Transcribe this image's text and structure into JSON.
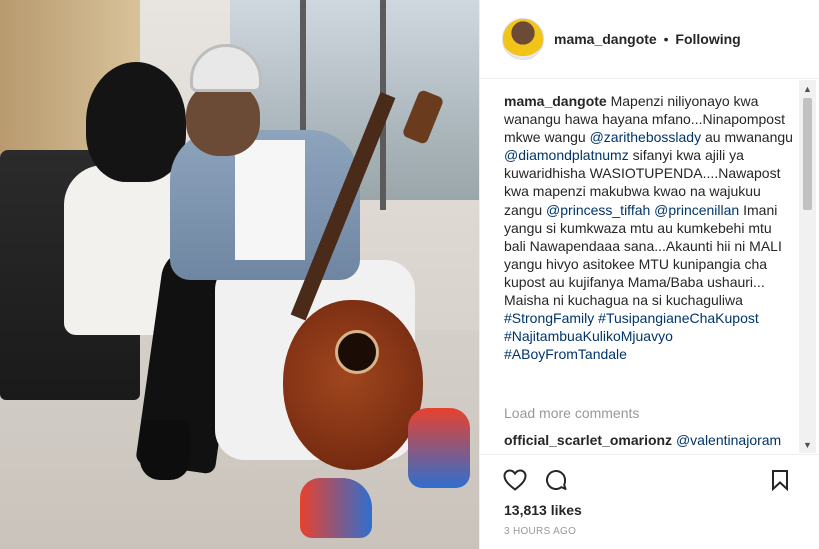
{
  "post": {
    "username": "mama_dangote",
    "separator": "•",
    "follow_status": "Following"
  },
  "caption": {
    "username": "mama_dangote",
    "part1": "Mapenzi niliyonayo kwa wanangu hawa hayana mfano...Ninapompost mkwe wangu",
    "mention1": "@zarithebosslady",
    "part2": "au mwanangu",
    "mention2": "@diamondplatnumz",
    "part3": "sifanyi kwa ajili ya kuwaridhisha WASIOTUPENDA....Nawapost kwa mapenzi makubwa kwao na wajukuu zangu",
    "mention3": "@princess_tiffah",
    "mention4": "@princenillan",
    "part4": "Imani yangu si kumkwaza mtu au kumkebehi mtu bali Nawapendaaa sana...Akaunti hii ni MALI yangu hivyo asitokee MTU kunipangia cha kupost au kujifanya Mama/Baba ushauri... Maisha ni kuchagua na si kuchaguliwa",
    "hashtag1": "#StrongFamily",
    "hashtag2": "#TusipangianeChaKupost",
    "hashtag3": "#NajitambuaKulikoMjuavyo",
    "hashtag4": "#ABoyFromTandale"
  },
  "load_more": "Load more comments",
  "comment": {
    "username": "official_scarlet_omarionz",
    "mention": "@valentinajoram"
  },
  "actions": {
    "like_icon": "heart-outline-icon",
    "comment_icon": "speech-bubble-icon",
    "save_icon": "bookmark-icon",
    "likes": "13,813 likes",
    "time": "3 HOURS AGO"
  },
  "colors": {
    "text": "#262626",
    "link": "#003569",
    "muted": "#999999",
    "border": "#efefef"
  }
}
